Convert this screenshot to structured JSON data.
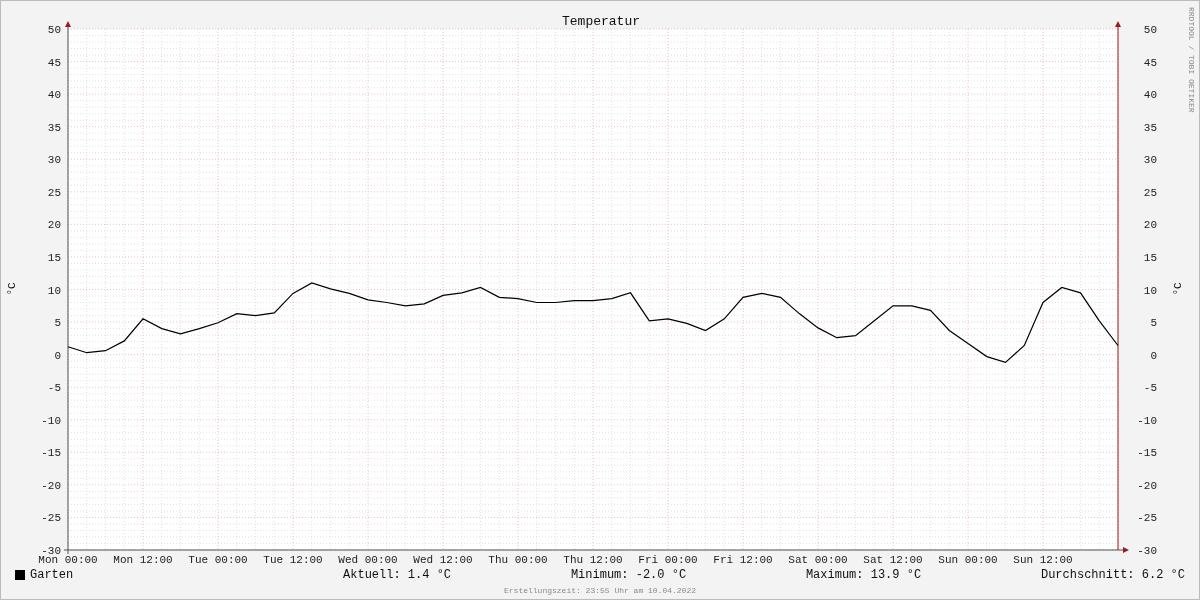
{
  "chart": {
    "chart_data": {
      "type": "line",
      "title": "Temperatur",
      "ylabel": "°C",
      "categories": [
        "Mon 00:00",
        null,
        null,
        null,
        "Mon 12:00",
        null,
        null,
        null,
        "Tue 00:00",
        null,
        null,
        null,
        "Tue 12:00",
        null,
        null,
        null,
        "Wed 00:00",
        null,
        null,
        null,
        "Wed 12:00",
        null,
        null,
        null,
        "Thu 00:00",
        null,
        null,
        null,
        "Thu 12:00",
        null,
        null,
        null,
        "Fri 00:00",
        null,
        null,
        null,
        "Fri 12:00",
        null,
        null,
        null,
        "Sat 00:00",
        null,
        null,
        null,
        "Sat 12:00",
        null,
        null,
        null,
        "Sun 00:00",
        null,
        null,
        null,
        "Sun 12:00",
        null,
        null,
        null,
        null
      ],
      "series": [
        {
          "name": "Garten",
          "color": "#000000",
          "values": [
            1.2,
            0.3,
            0.6,
            2.1,
            5.5,
            4.0,
            3.2,
            4.0,
            4.9,
            6.3,
            6.0,
            6.4,
            9.4,
            11.0,
            10.1,
            9.4,
            8.4,
            8.0,
            7.5,
            7.8,
            9.1,
            9.5,
            10.3,
            8.8,
            8.6,
            8.0,
            8.0,
            8.3,
            8.3,
            8.6,
            9.5,
            5.2,
            5.5,
            4.8,
            3.7,
            5.5,
            8.8,
            9.4,
            8.8,
            6.3,
            4.1,
            2.6,
            2.9,
            5.2,
            7.5,
            7.5,
            6.8,
            3.7,
            1.7,
            -0.3,
            -1.2,
            1.4,
            8.0,
            10.3,
            9.5,
            5.2,
            1.4
          ]
        }
      ],
      "ylim": [
        -30,
        50
      ],
      "grid": true,
      "yticks": [
        {
          "value": -30,
          "label": "-30"
        },
        {
          "value": -25,
          "label": "-25"
        },
        {
          "value": -20,
          "label": "-20"
        },
        {
          "value": -15,
          "label": "-15"
        },
        {
          "value": -10,
          "label": "-10"
        },
        {
          "value": -5,
          "label": "-5"
        },
        {
          "value": 0,
          "label": "0"
        },
        {
          "value": 5,
          "label": "5"
        },
        {
          "value": 10,
          "label": "10"
        },
        {
          "value": 15,
          "label": "15"
        },
        {
          "value": 20,
          "label": "20"
        },
        {
          "value": 25,
          "label": "25"
        },
        {
          "value": 30,
          "label": "30"
        },
        {
          "value": 35,
          "label": "35"
        },
        {
          "value": 40,
          "label": "40"
        },
        {
          "value": 45,
          "label": "45"
        },
        {
          "value": 50,
          "label": "50"
        }
      ]
    },
    "right_ylabel": "°C",
    "right_yticks": [
      "50",
      "45",
      "40",
      "35",
      "30",
      "25",
      "20",
      "15",
      "10",
      "5",
      "0",
      "-5",
      "-10",
      "-15",
      "-20",
      "-25",
      "-30"
    ],
    "side_label": "RRDTOOL / TOBI OETIKER"
  },
  "legend": {
    "stats": [
      "Aktuell: 1.4 °C",
      "Minimum: -2.0 °C",
      "Maximum: 13.9 °C",
      "Durchschnitt: 6.2 °C"
    ]
  },
  "footer": "Erstellungszeit: 23:55 Uhr am 10.04.2022"
}
